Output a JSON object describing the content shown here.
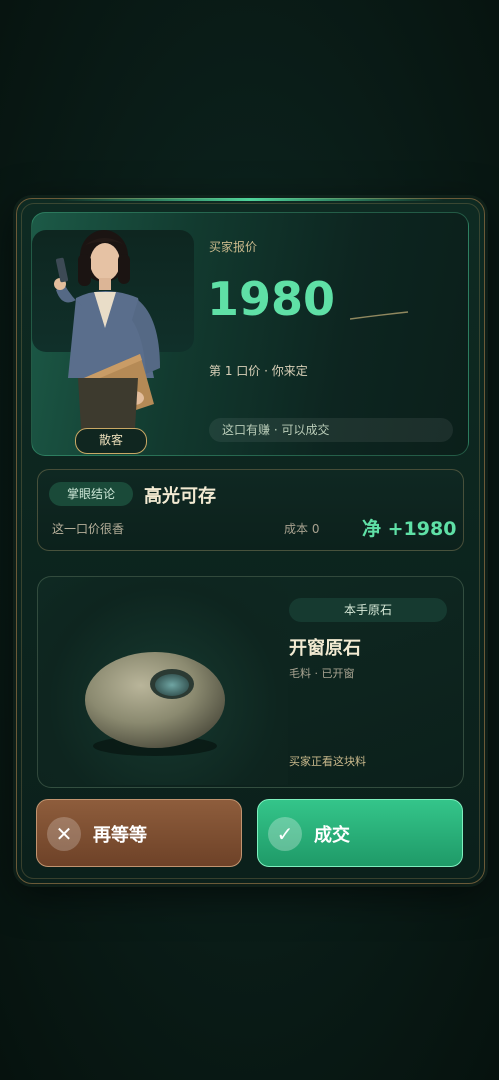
{
  "buyer": {
    "visitor_badge": "散客",
    "offer_label": "买家报价",
    "price": "1980",
    "bid_round": "第 1 口价 · 你来定",
    "hint": "这口有赚 · 可以成交"
  },
  "verdict": {
    "tag": "掌眼结论",
    "title": "高光可存",
    "note": "这一口价很香",
    "cost": "成本 0",
    "net": "净 +1980"
  },
  "stone": {
    "tag": "本手原石",
    "title": "开窗原石",
    "meta": "毛料 · 已开窗",
    "status": "买家正看这块料"
  },
  "actions": {
    "wait_label": "再等等",
    "wait_icon": "close-icon",
    "deal_label": "成交",
    "deal_icon": "check-icon"
  },
  "colors": {
    "accent": "#5fe0a6",
    "deal_button": "#2bb57c",
    "wait_button": "#7e4f32"
  }
}
